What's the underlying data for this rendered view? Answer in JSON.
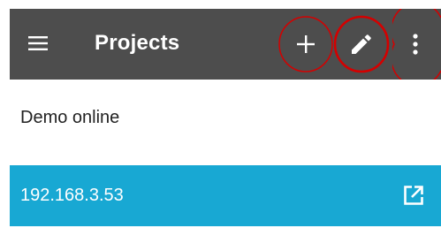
{
  "app_bar": {
    "title": "Projects",
    "background": "#4d4d4d",
    "menu_icon": "hamburger-menu-icon",
    "actions": [
      {
        "name": "add",
        "icon": "plus-icon",
        "highlight": "red-circle"
      },
      {
        "name": "edit",
        "icon": "pencil-icon",
        "highlight": "red-circle"
      },
      {
        "name": "more",
        "icon": "vertical-dots-icon",
        "highlight": "red-circle"
      }
    ]
  },
  "projects": [
    {
      "label": "Demo online",
      "selected": false
    },
    {
      "label": "192.168.3.53",
      "selected": true,
      "trailing_icon": "open-in-new-icon"
    }
  ],
  "colors": {
    "selected_row": "#18a8d3",
    "annotation_red": "#d40000",
    "text": "#222222"
  }
}
